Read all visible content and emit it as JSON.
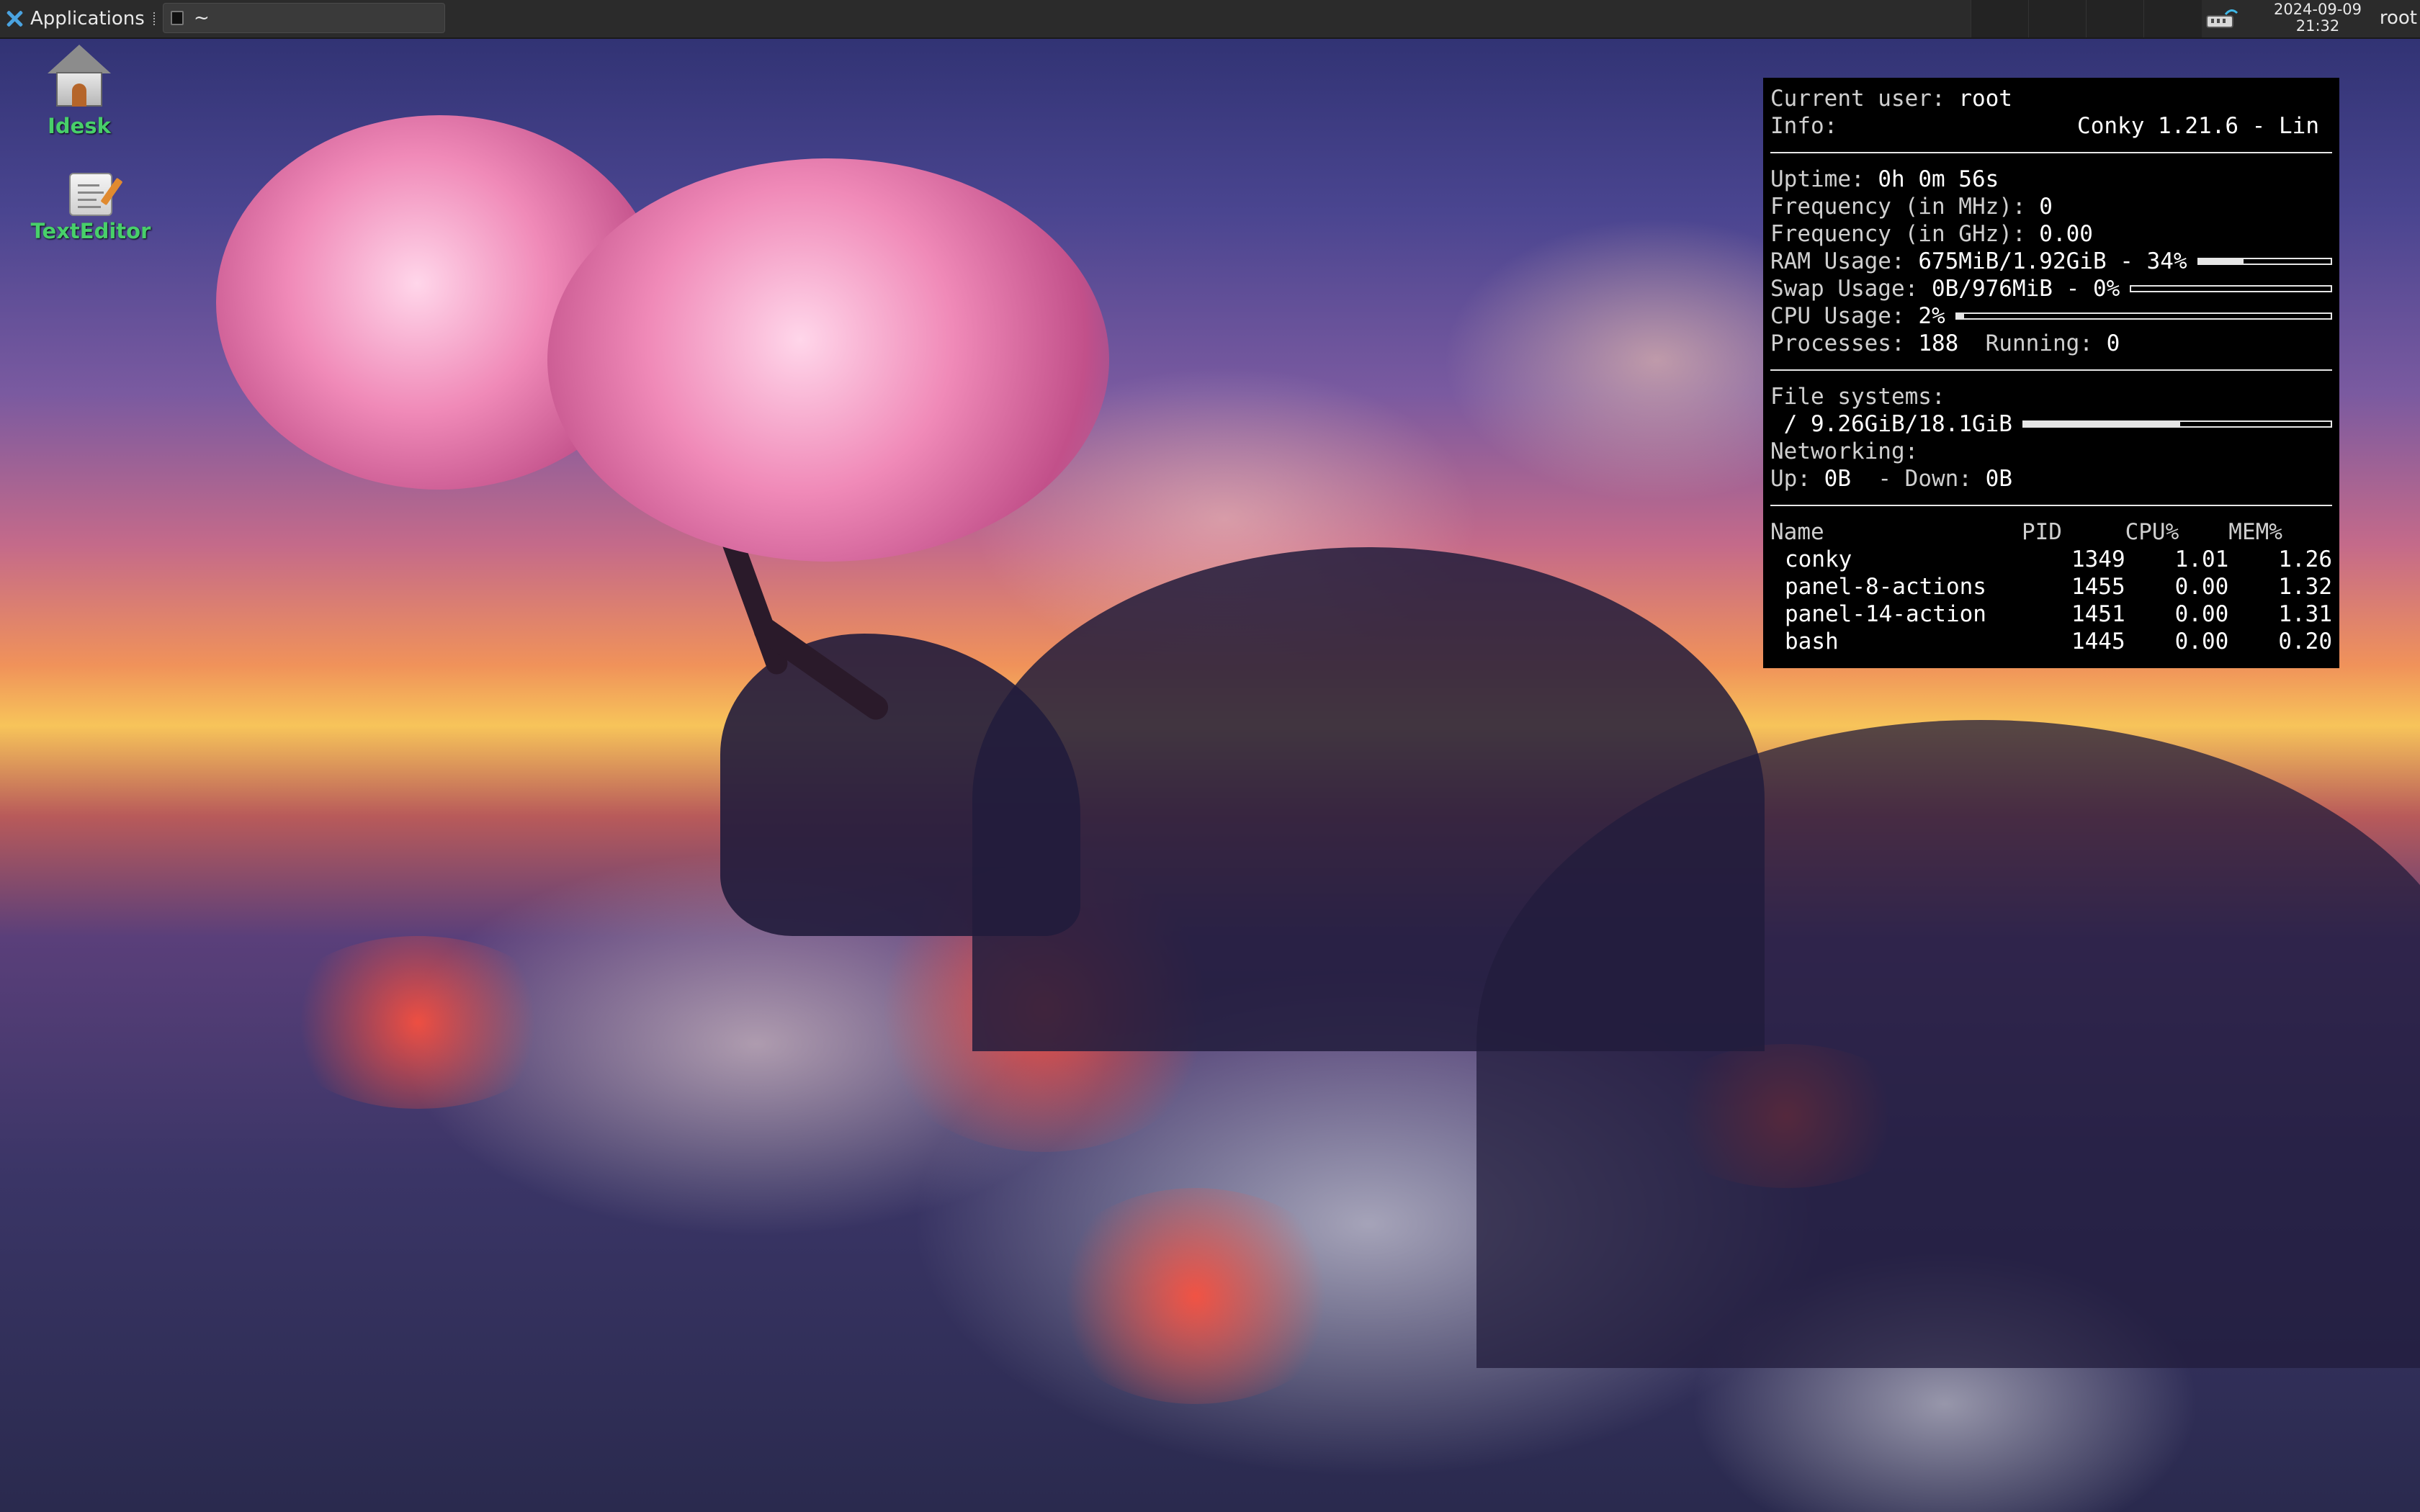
{
  "panel": {
    "applications_label": "Applications",
    "task_title": "~",
    "clock_date": "2024-09-09",
    "clock_time": "21:32",
    "user": "root"
  },
  "desktop_icons": [
    {
      "label": "Idesk",
      "icon": "home-folder-icon"
    },
    {
      "label": "TextEditor",
      "icon": "text-editor-icon"
    }
  ],
  "conky": {
    "current_user_label": "Current user:",
    "current_user": "root",
    "info_label": "Info:",
    "info_value": "Conky 1.21.6 - Lin",
    "uptime_label": "Uptime:",
    "uptime": "0h 0m 56s",
    "freq_mhz_label": "Frequency (in MHz):",
    "freq_mhz": "0",
    "freq_ghz_label": "Frequency (in GHz):",
    "freq_ghz": "0.00",
    "ram_label": "RAM Usage:",
    "ram_value": "675MiB/1.92GiB - 34%",
    "ram_percent": 34,
    "swap_label": "Swap Usage:",
    "swap_value": "0B/976MiB - 0%",
    "swap_percent": 0,
    "cpu_label": "CPU Usage:",
    "cpu_value": "2%",
    "cpu_percent": 2,
    "processes_label": "Processes:",
    "processes": "188",
    "running_label": "Running:",
    "running": "0",
    "fs_label": "File systems:",
    "fs_value": "/ 9.26GiB/18.1GiB",
    "fs_percent": 51,
    "net_label": "Networking:",
    "up_label": "Up:",
    "up_value": "0B",
    "down_label": "- Down:",
    "down_value": "0B",
    "table_headers": [
      "Name",
      "PID",
      "CPU%",
      "MEM%"
    ],
    "processes_top": [
      {
        "name": "conky",
        "pid": "1349",
        "cpu": "1.01",
        "mem": "1.26"
      },
      {
        "name": "panel-8-actions",
        "pid": "1455",
        "cpu": "0.00",
        "mem": "1.32"
      },
      {
        "name": "panel-14-action",
        "pid": "1451",
        "cpu": "0.00",
        "mem": "1.31"
      },
      {
        "name": "bash",
        "pid": "1445",
        "cpu": "0.00",
        "mem": "0.20"
      }
    ]
  },
  "colors": {
    "panel_bg": "#2b2b2b",
    "icon_label": "#48d06a",
    "conky_bg": "#000000",
    "conky_fg": "#e6e6e6"
  }
}
